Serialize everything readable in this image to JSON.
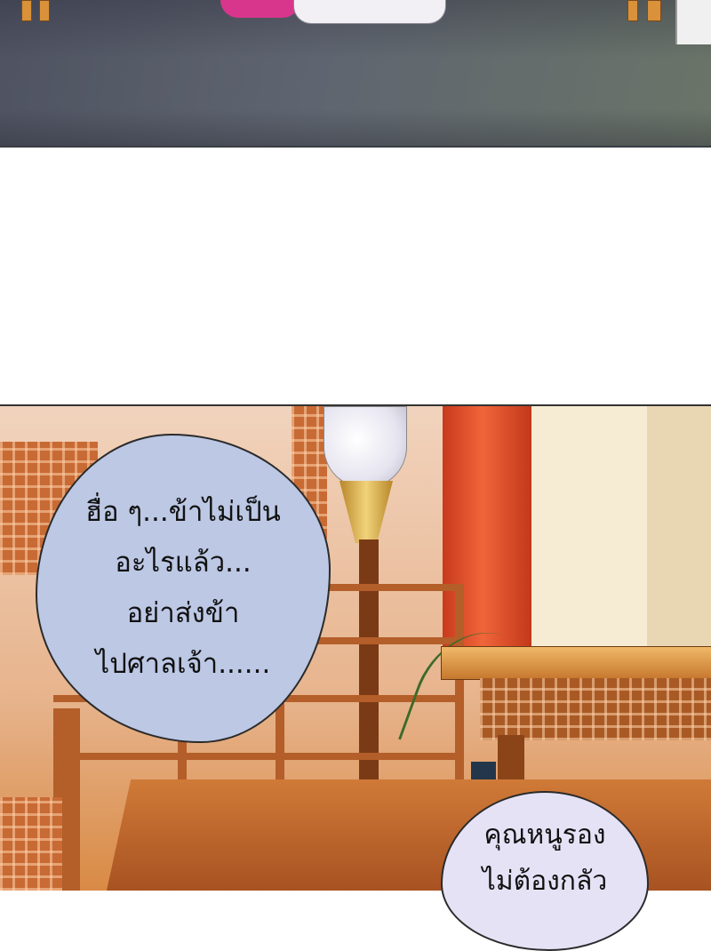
{
  "panels": {
    "top": {
      "description_hidden": true
    },
    "bottom": {
      "description_hidden": true
    }
  },
  "dialogue": {
    "bubble_1": {
      "lines": [
        "ฮื่อ ๆ...ข้าไม่เป็น",
        "อะไรแล้ว...",
        "อย่าส่งข้า",
        "ไปศาลเจ้า......"
      ]
    },
    "bubble_2": {
      "lines": [
        "คุณหนูรอง",
        "ไม่ต้องกลัว"
      ]
    }
  },
  "colors": {
    "bubble_1_fill": "#bcc8e4",
    "bubble_2_fill": "#e6e2f6",
    "pillar_red": "#e2502a",
    "wood_orange": "#d98a45"
  }
}
